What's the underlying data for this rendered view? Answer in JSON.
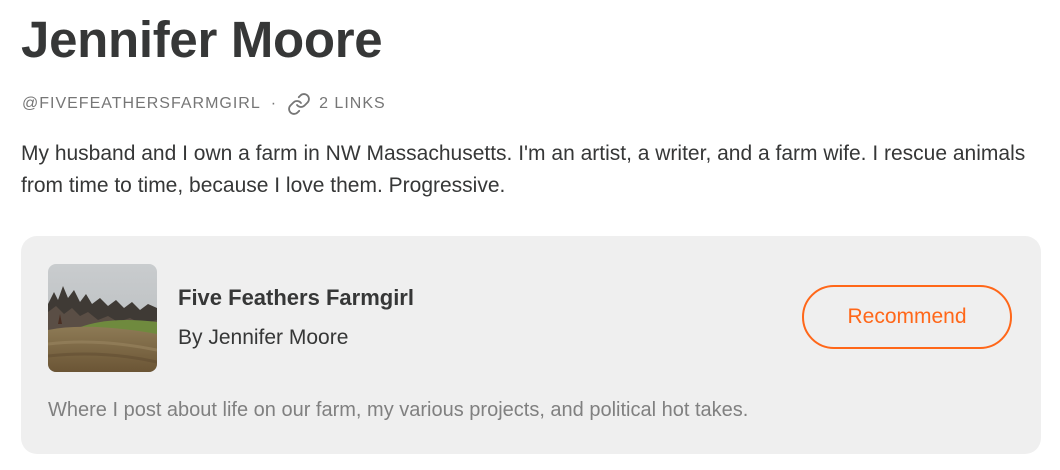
{
  "profile": {
    "name": "Jennifer Moore",
    "handle": "@FIVEFEATHERSFARMGIRL",
    "separator": "·",
    "links_label": "2 LINKS",
    "bio": "My husband and I own a farm in NW Massachusetts. I'm an artist, a writer, and a farm wife. I rescue animals from time to time, because I love them. Progressive."
  },
  "publication": {
    "name": "Five Feathers Farmgirl",
    "author_line": "By Jennifer Moore",
    "recommend_label": "Recommend",
    "description": "Where I post about life on our farm, my various projects, and political hot takes.",
    "thumbnail_icon": "farm-field-photo"
  },
  "colors": {
    "accent": "#ff6719",
    "text": "#363737",
    "muted": "#767676",
    "card_bg": "#efefef"
  }
}
